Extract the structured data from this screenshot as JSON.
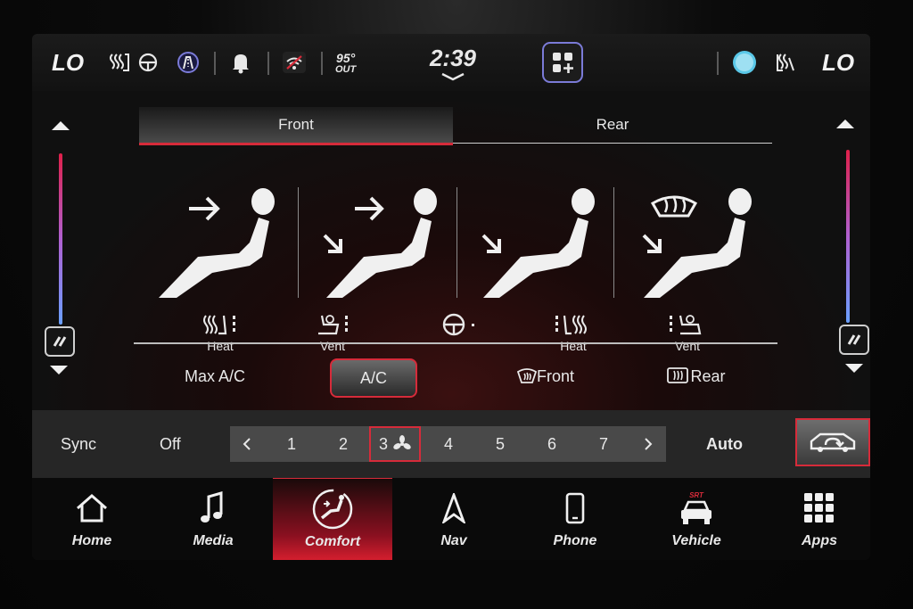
{
  "status": {
    "left_temp": "LO",
    "right_temp": "LO",
    "outside_temp": "95°",
    "outside_label": "OUT",
    "clock": "2:39"
  },
  "tabs": {
    "front": "Front",
    "rear": "Rear"
  },
  "seat_controls": [
    {
      "label": "Heat",
      "icon": "seat-heat-icon"
    },
    {
      "label": "Vent",
      "icon": "seat-vent-icon"
    },
    {
      "label": "",
      "icon": "steering-wheel-heat-icon"
    },
    {
      "label": "Heat",
      "icon": "seat-heat-icon"
    },
    {
      "label": "Vent",
      "icon": "seat-vent-icon"
    }
  ],
  "climate_buttons": {
    "max_ac": "Max A/C",
    "ac": "A/C",
    "front_defrost": "Front",
    "rear_defrost": "Rear"
  },
  "fan": {
    "sync": "Sync",
    "off": "Off",
    "speeds": [
      "1",
      "2",
      "3",
      "4",
      "5",
      "6",
      "7"
    ],
    "active_speed": "3",
    "auto": "Auto"
  },
  "nav": {
    "home": "Home",
    "media": "Media",
    "comfort": "Comfort",
    "nav": "Nav",
    "phone": "Phone",
    "vehicle": "Vehicle",
    "vehicle_badge": "SRT",
    "apps": "Apps"
  },
  "colors": {
    "accent": "#d62b3a",
    "widget_border": "#7b7bd8"
  }
}
